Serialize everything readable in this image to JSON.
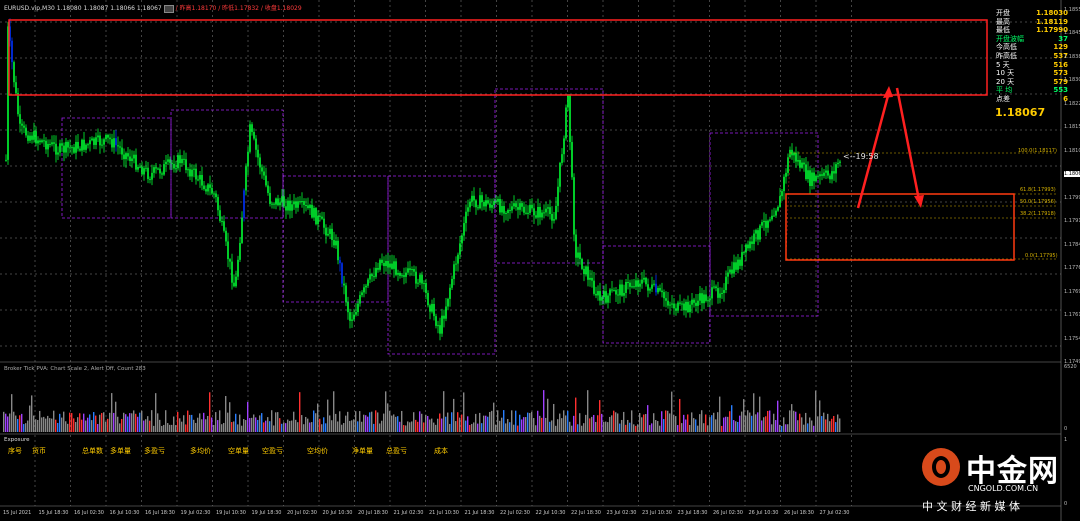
{
  "header": {
    "symbol": "EURUSD.vip,M30",
    "ohlc": "1.18080 1.18087 1.18066 1.18067",
    "items": [
      {
        "label": "/ 昨高",
        "value": "1.18170"
      },
      {
        "label": "/ 昨低",
        "value": "1.17832"
      },
      {
        "label": "/ 收盘",
        "value": "1.18029"
      }
    ]
  },
  "info_panel": {
    "rows": [
      {
        "k": "开盘",
        "v": "1.18030",
        "color": "#ffcc00"
      },
      {
        "k": "最高",
        "v": "1.18119",
        "color": "#ffcc00"
      },
      {
        "k": "最低",
        "v": "1.17990",
        "color": "#ffcc00"
      },
      {
        "k": "开盘波幅",
        "v": "37",
        "color": "#00ff66"
      },
      {
        "k": "今高低",
        "v": "129",
        "color": "#ffcc00"
      },
      {
        "k": "昨高低",
        "v": "537",
        "color": "#ffcc00"
      },
      {
        "k": "5   天",
        "v": "516",
        "color": "#ffcc00"
      },
      {
        "k": "10  天",
        "v": "573",
        "color": "#ffcc00"
      },
      {
        "k": "20  天",
        "v": "579",
        "color": "#ffcc00"
      },
      {
        "k": "平  均",
        "v": "553",
        "color": "#00ff66"
      },
      {
        "k": "点差",
        "v": "6",
        "color": "#ffcc00"
      }
    ],
    "current_price": "1.18067"
  },
  "price_axis": [
    "1.18550",
    "1.18455",
    "1.18380",
    "1.18305",
    "1.18225",
    "1.18150",
    "1.18105",
    "1.18067",
    "1.17990",
    "1.17915",
    "1.17840",
    "1.17765",
    "1.17690",
    "1.17615",
    "1.17540",
    "1.17495"
  ],
  "timer": "<--19:58",
  "fib_levels": [
    {
      "label": "100.0(1.18117)"
    },
    {
      "label": "61.8(1.17993)"
    },
    {
      "label": "50.0(1.17956)"
    },
    {
      "label": "38.2(1.17918)"
    },
    {
      "label": "0.0(1.17795)"
    }
  ],
  "volume_panel": {
    "title": "Broker Tick PVA:   Chart Scale 2, Alert Off,  Count  283",
    "axis_top": "6520",
    "axis_bottom": "0"
  },
  "exposure_panel": {
    "title": "Exposure",
    "columns": [
      "序号",
      "货币",
      "总单数",
      "多单量",
      "多盈亏",
      "多均价",
      "空单量",
      "空盈亏",
      "空均价",
      "净单量",
      "总盈亏",
      "成本"
    ],
    "axis_top": "1",
    "axis_bottom": "0"
  },
  "time_axis": [
    "15 Jul 2021",
    "15 Jul 18:30",
    "16 Jul 02:30",
    "16 Jul 10:30",
    "16 Jul 18:30",
    "19 Jul 02:30",
    "19 Jul 10:30",
    "19 Jul 18:30",
    "20 Jul 02:30",
    "20 Jul 10:30",
    "20 Jul 18:30",
    "21 Jul 02:30",
    "21 Jul 10:30",
    "21 Jul 18:30",
    "22 Jul 02:30",
    "22 Jul 10:30",
    "22 Jul 18:30",
    "23 Jul 02:30",
    "23 Jul 10:30",
    "23 Jul 18:30",
    "26 Jul 02:30",
    "26 Jul 10:30",
    "26 Jul 18:30",
    "27 Jul 02:30"
  ],
  "watermark": {
    "brand": "中金网",
    "url": "CNGOLD.COM.CN",
    "slogan": "中 文 财 经 新 媒 体"
  },
  "colors": {
    "background": "#000000",
    "bull": "#00ff33",
    "bear": "#0033ff",
    "annotation": "#ff2020",
    "grid": "#ffffff",
    "box": "#a020f0",
    "fib": "#d4b000"
  }
}
